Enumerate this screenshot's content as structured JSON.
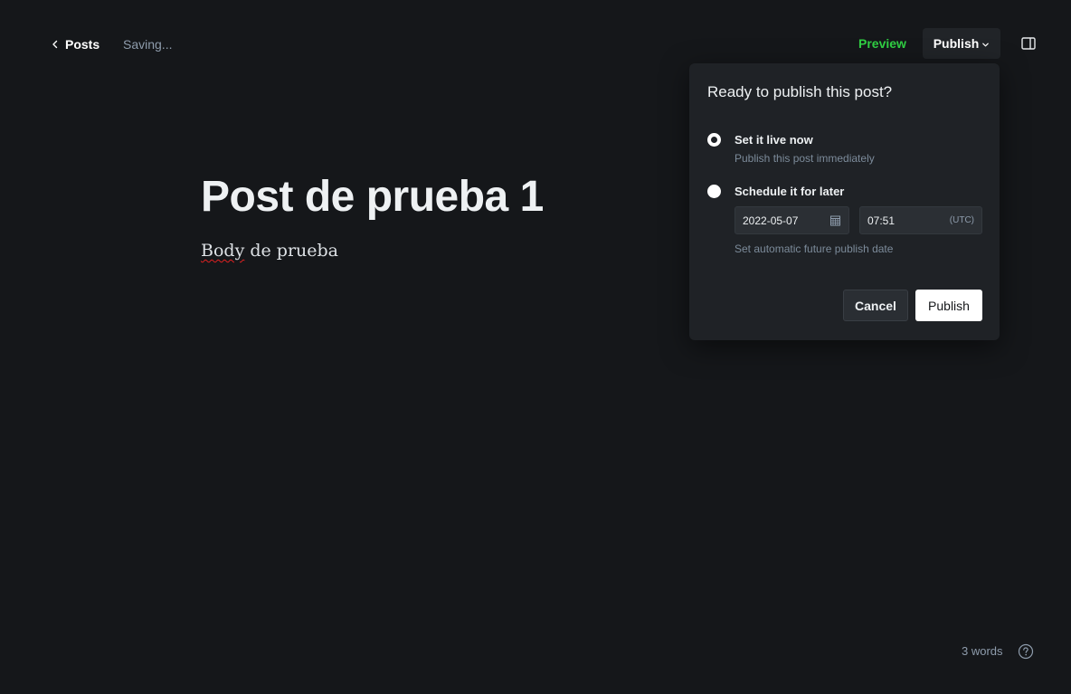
{
  "header": {
    "back_label": "Posts",
    "status": "Saving...",
    "preview_label": "Preview",
    "publish_label": "Publish",
    "preview_color": "#30cf43"
  },
  "editor": {
    "title": "Post de prueba 1",
    "body_misspelled": "Body",
    "body_rest": " de prueba"
  },
  "publish_popover": {
    "title": "Ready to publish this post?",
    "options": [
      {
        "label": "Set it live now",
        "description": "Publish this post immediately",
        "selected": true
      },
      {
        "label": "Schedule it for later",
        "selected": false
      }
    ],
    "date_value": "2022-05-07",
    "time_value": "07:51",
    "timezone": "(UTC)",
    "schedule_hint": "Set automatic future publish date",
    "cancel_label": "Cancel",
    "publish_label": "Publish"
  },
  "footer": {
    "word_count": "3 words"
  },
  "icons": {
    "back": "chevron-left-icon",
    "caret": "chevron-down-icon",
    "sidebar": "sidebar-toggle-icon",
    "calendar": "calendar-icon",
    "help": "help-icon"
  }
}
